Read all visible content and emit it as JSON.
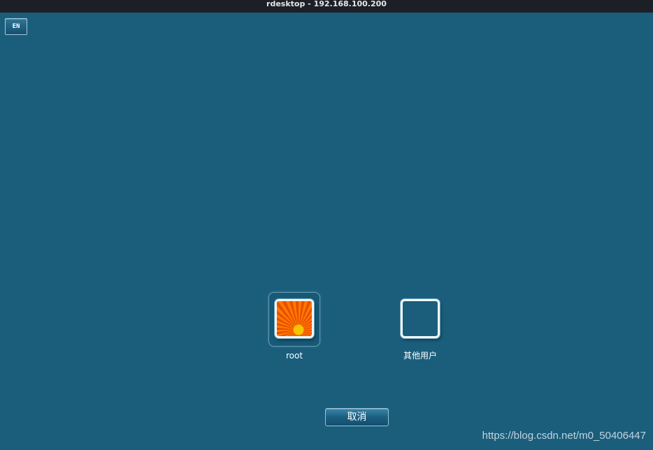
{
  "window": {
    "title": "rdesktop - 192.168.100.200"
  },
  "language": {
    "label": "EN"
  },
  "users": [
    {
      "name": "root",
      "avatar_icon": "orange-flower-icon"
    },
    {
      "name": "其他用户",
      "avatar_icon": "blank-user-icon"
    }
  ],
  "actions": {
    "cancel_label": "取消"
  },
  "watermark": "https://blog.csdn.net/m0_50406447",
  "colors": {
    "desktop_background": "#1a5e7c",
    "titlebar_background": "#1c1f26"
  }
}
